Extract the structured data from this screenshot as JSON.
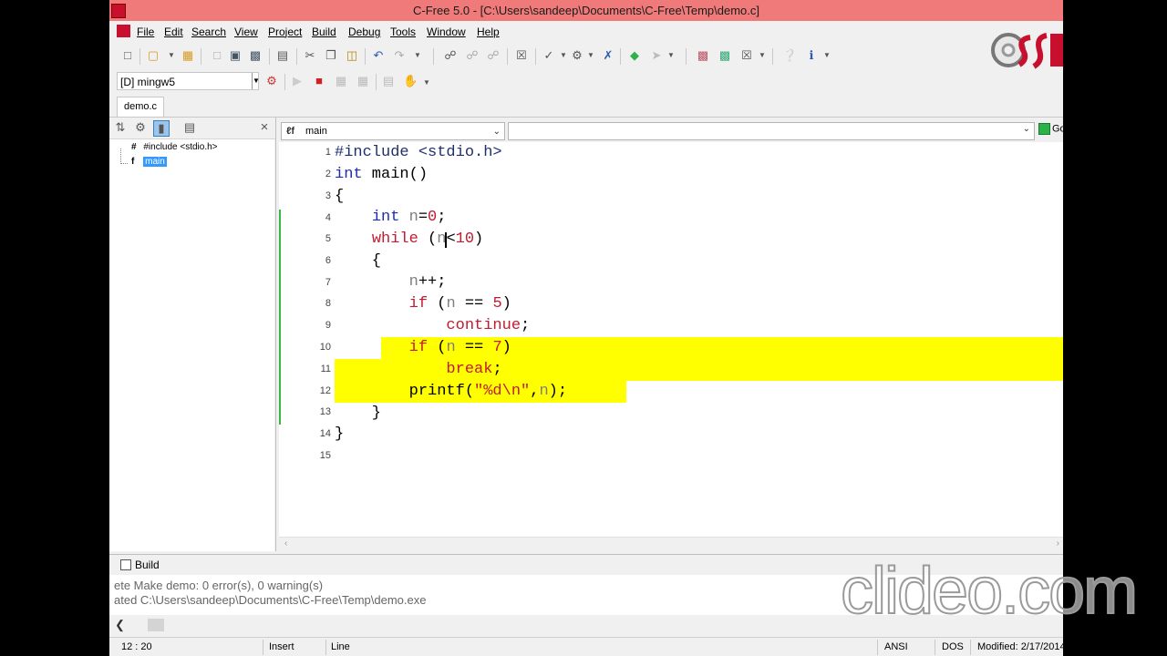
{
  "window": {
    "title": "C-Free 5.0 - [C:\\Users\\sandeep\\Documents\\C-Free\\Temp\\demo.c]"
  },
  "menu": [
    "File",
    "Edit",
    "Search",
    "View",
    "Project",
    "Build",
    "Debug",
    "Tools",
    "Window",
    "Help"
  ],
  "toolbar": {
    "icons": [
      "new-file-icon",
      "open-folder-icon",
      "open-project-icon",
      "cut-icon",
      "copy-icon",
      "paste-icon",
      "save-icon",
      "save-all-icon",
      "print-icon",
      "undo-icon",
      "redo-icon",
      "find-icon",
      "replace-icon",
      "bookmark-icon",
      "compile-icon",
      "run-icon",
      "stop-icon",
      "step-icon",
      "step-over-icon",
      "help-icon",
      "info-icon"
    ]
  },
  "compiler": {
    "selected": "[D] mingw5"
  },
  "tabs": [
    {
      "label": "demo.c"
    }
  ],
  "symbols": {
    "items": [
      {
        "label": "#include <stdio.h>",
        "icon": "hash-icon"
      },
      {
        "label": "main",
        "icon": "function-icon",
        "selected": true
      }
    ]
  },
  "editor": {
    "function_select": "main",
    "go_label": "Go",
    "line_numbers": [
      "1",
      "2",
      "3",
      "4",
      "5",
      "6",
      "7",
      "8",
      "9",
      "10",
      "11",
      "12",
      "13",
      "14",
      "15"
    ],
    "highlight_color": "#ffff00"
  },
  "build": {
    "title": "Build",
    "lines": [
      "ete Make demo: 0 error(s), 0 warning(s)",
      "ated C:\\Users\\sandeep\\Documents\\C-Free\\Temp\\demo.exe"
    ]
  },
  "status": {
    "position": "12 : 20",
    "mode": "Insert",
    "unit": "Line",
    "encoding": "ANSI",
    "line_endings": "DOS",
    "modified": "Modified: 2/17/2014"
  },
  "watermark": "clideo.com"
}
